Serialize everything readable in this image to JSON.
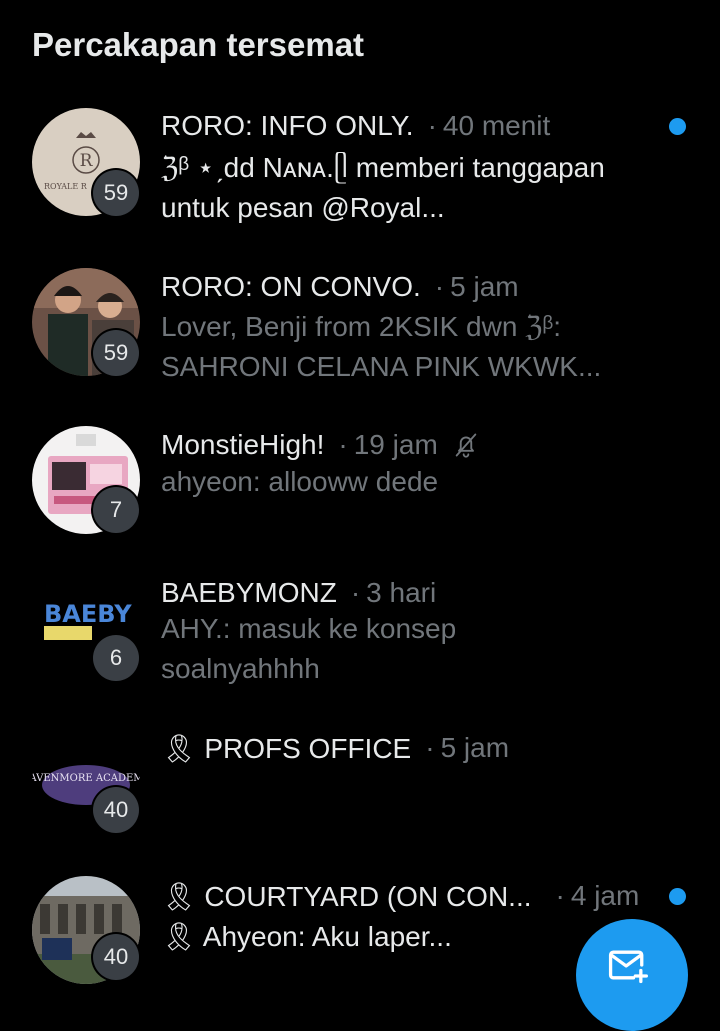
{
  "section": {
    "title": "Percakapan tersemat"
  },
  "conversations": [
    {
      "name": "RORO: INFO ONLY.",
      "time": "40 menit",
      "count": "59",
      "preview": "ℨᵝ ⋆ˏdd Nᴀɴᴀ.ᥫ memberi tanggapan untuk pesan @Royal...",
      "unread": true,
      "avatar_label": "ROYALE R"
    },
    {
      "name": "RORO: ON CONVO.",
      "time": "5 jam",
      "count": "59",
      "preview": "Lover, Benji from 2KSIK dwn ℨᵝ: SAHRONI CELANA PINK WKWK...",
      "unread": false
    },
    {
      "name": "MonstieHigh!",
      "time": "19 jam",
      "count": "7",
      "preview": "ahyeon: allooww dede",
      "unread": false,
      "muted": true
    },
    {
      "name": "BAEBYMONZ",
      "time": "3 hari",
      "count": "6",
      "preview": "AHY.: masuk ke konsep soalnyahhhh",
      "unread": false,
      "avatar_label": "BAEBY MON"
    },
    {
      "name": "🎗 PROFS OFFICE",
      "time": "5 jam",
      "count": "40",
      "preview": "",
      "unread": false,
      "avatar_label": "RAVENMORE ACADEMY"
    },
    {
      "name": "🎗 COURTYARD (ON CON...",
      "time": "4 jam",
      "count": "40",
      "preview": "🎗 Ahyeon: Aku laper...",
      "unread": true
    }
  ],
  "colors": {
    "background": "#000000",
    "text_primary": "#e7e9ea",
    "text_secondary": "#71767b",
    "accent": "#1d9bf0"
  },
  "fab": {
    "icon": "new-message-icon"
  }
}
